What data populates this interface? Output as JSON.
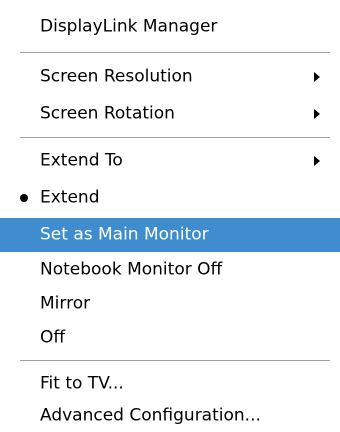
{
  "menu": {
    "title": "DisplayLink Manager",
    "screen_resolution": "Screen Resolution",
    "screen_rotation": "Screen Rotation",
    "extend_to": "Extend To",
    "extend": "Extend",
    "set_as_main_monitor": "Set as Main Monitor",
    "notebook_monitor_off": "Notebook Monitor Off",
    "mirror": "Mirror",
    "off": "Off",
    "fit_to_tv": "Fit to TV...",
    "advanced_configuration": "Advanced Configuration...",
    "selected_item": "Extend",
    "highlighted_item": "Set as Main Monitor",
    "submenu_items": [
      "Screen Resolution",
      "Screen Rotation",
      "Extend To"
    ]
  },
  "colors": {
    "highlight": "#3f8ccf",
    "highlight_text": "#ffffff",
    "separator": "#a0a0a0",
    "background": "#ffffff"
  },
  "icons": {
    "submenu": "submenu-arrow-icon",
    "selected": "bullet-icon"
  }
}
